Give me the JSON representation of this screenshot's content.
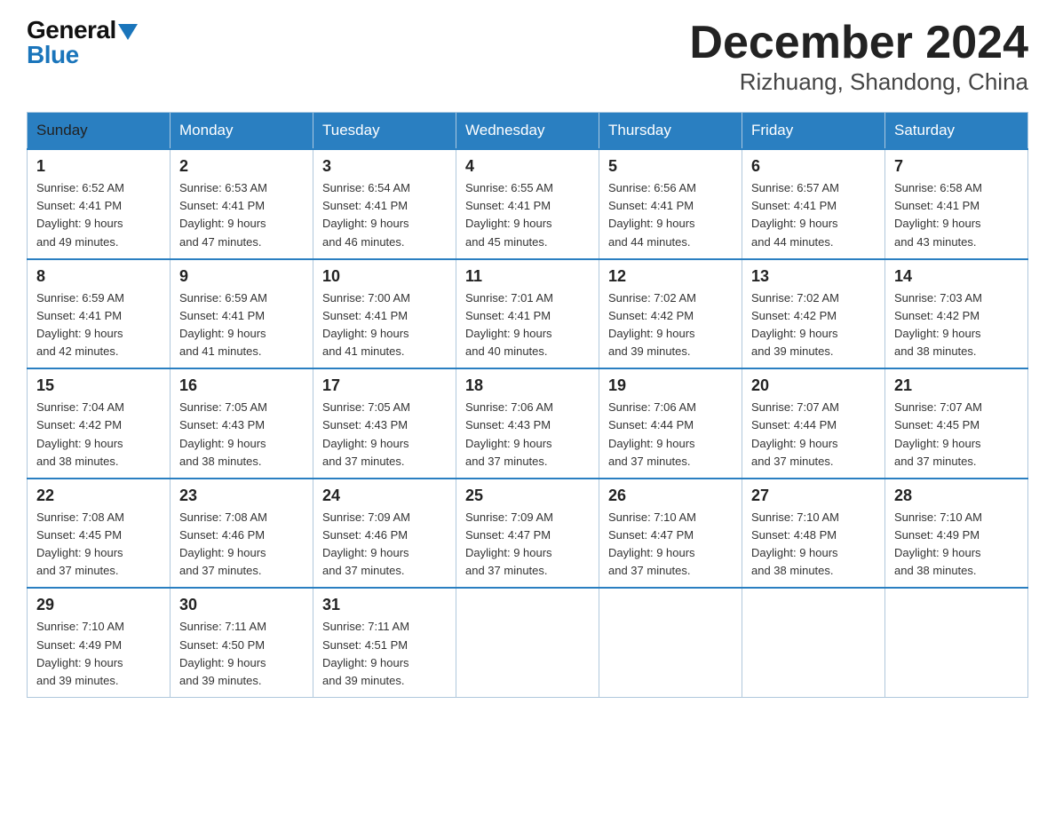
{
  "header": {
    "title": "December 2024",
    "subtitle": "Rizhuang, Shandong, China",
    "logo_general": "General",
    "logo_blue": "Blue"
  },
  "weekdays": [
    "Sunday",
    "Monday",
    "Tuesday",
    "Wednesday",
    "Thursday",
    "Friday",
    "Saturday"
  ],
  "weeks": [
    [
      {
        "day": "1",
        "sunrise": "6:52 AM",
        "sunset": "4:41 PM",
        "daylight": "9 hours and 49 minutes."
      },
      {
        "day": "2",
        "sunrise": "6:53 AM",
        "sunset": "4:41 PM",
        "daylight": "9 hours and 47 minutes."
      },
      {
        "day": "3",
        "sunrise": "6:54 AM",
        "sunset": "4:41 PM",
        "daylight": "9 hours and 46 minutes."
      },
      {
        "day": "4",
        "sunrise": "6:55 AM",
        "sunset": "4:41 PM",
        "daylight": "9 hours and 45 minutes."
      },
      {
        "day": "5",
        "sunrise": "6:56 AM",
        "sunset": "4:41 PM",
        "daylight": "9 hours and 44 minutes."
      },
      {
        "day": "6",
        "sunrise": "6:57 AM",
        "sunset": "4:41 PM",
        "daylight": "9 hours and 44 minutes."
      },
      {
        "day": "7",
        "sunrise": "6:58 AM",
        "sunset": "4:41 PM",
        "daylight": "9 hours and 43 minutes."
      }
    ],
    [
      {
        "day": "8",
        "sunrise": "6:59 AM",
        "sunset": "4:41 PM",
        "daylight": "9 hours and 42 minutes."
      },
      {
        "day": "9",
        "sunrise": "6:59 AM",
        "sunset": "4:41 PM",
        "daylight": "9 hours and 41 minutes."
      },
      {
        "day": "10",
        "sunrise": "7:00 AM",
        "sunset": "4:41 PM",
        "daylight": "9 hours and 41 minutes."
      },
      {
        "day": "11",
        "sunrise": "7:01 AM",
        "sunset": "4:41 PM",
        "daylight": "9 hours and 40 minutes."
      },
      {
        "day": "12",
        "sunrise": "7:02 AM",
        "sunset": "4:42 PM",
        "daylight": "9 hours and 39 minutes."
      },
      {
        "day": "13",
        "sunrise": "7:02 AM",
        "sunset": "4:42 PM",
        "daylight": "9 hours and 39 minutes."
      },
      {
        "day": "14",
        "sunrise": "7:03 AM",
        "sunset": "4:42 PM",
        "daylight": "9 hours and 38 minutes."
      }
    ],
    [
      {
        "day": "15",
        "sunrise": "7:04 AM",
        "sunset": "4:42 PM",
        "daylight": "9 hours and 38 minutes."
      },
      {
        "day": "16",
        "sunrise": "7:05 AM",
        "sunset": "4:43 PM",
        "daylight": "9 hours and 38 minutes."
      },
      {
        "day": "17",
        "sunrise": "7:05 AM",
        "sunset": "4:43 PM",
        "daylight": "9 hours and 37 minutes."
      },
      {
        "day": "18",
        "sunrise": "7:06 AM",
        "sunset": "4:43 PM",
        "daylight": "9 hours and 37 minutes."
      },
      {
        "day": "19",
        "sunrise": "7:06 AM",
        "sunset": "4:44 PM",
        "daylight": "9 hours and 37 minutes."
      },
      {
        "day": "20",
        "sunrise": "7:07 AM",
        "sunset": "4:44 PM",
        "daylight": "9 hours and 37 minutes."
      },
      {
        "day": "21",
        "sunrise": "7:07 AM",
        "sunset": "4:45 PM",
        "daylight": "9 hours and 37 minutes."
      }
    ],
    [
      {
        "day": "22",
        "sunrise": "7:08 AM",
        "sunset": "4:45 PM",
        "daylight": "9 hours and 37 minutes."
      },
      {
        "day": "23",
        "sunrise": "7:08 AM",
        "sunset": "4:46 PM",
        "daylight": "9 hours and 37 minutes."
      },
      {
        "day": "24",
        "sunrise": "7:09 AM",
        "sunset": "4:46 PM",
        "daylight": "9 hours and 37 minutes."
      },
      {
        "day": "25",
        "sunrise": "7:09 AM",
        "sunset": "4:47 PM",
        "daylight": "9 hours and 37 minutes."
      },
      {
        "day": "26",
        "sunrise": "7:10 AM",
        "sunset": "4:47 PM",
        "daylight": "9 hours and 37 minutes."
      },
      {
        "day": "27",
        "sunrise": "7:10 AM",
        "sunset": "4:48 PM",
        "daylight": "9 hours and 38 minutes."
      },
      {
        "day": "28",
        "sunrise": "7:10 AM",
        "sunset": "4:49 PM",
        "daylight": "9 hours and 38 minutes."
      }
    ],
    [
      {
        "day": "29",
        "sunrise": "7:10 AM",
        "sunset": "4:49 PM",
        "daylight": "9 hours and 39 minutes."
      },
      {
        "day": "30",
        "sunrise": "7:11 AM",
        "sunset": "4:50 PM",
        "daylight": "9 hours and 39 minutes."
      },
      {
        "day": "31",
        "sunrise": "7:11 AM",
        "sunset": "4:51 PM",
        "daylight": "9 hours and 39 minutes."
      },
      null,
      null,
      null,
      null
    ]
  ],
  "labels": {
    "sunrise": "Sunrise:",
    "sunset": "Sunset:",
    "daylight": "Daylight:"
  }
}
